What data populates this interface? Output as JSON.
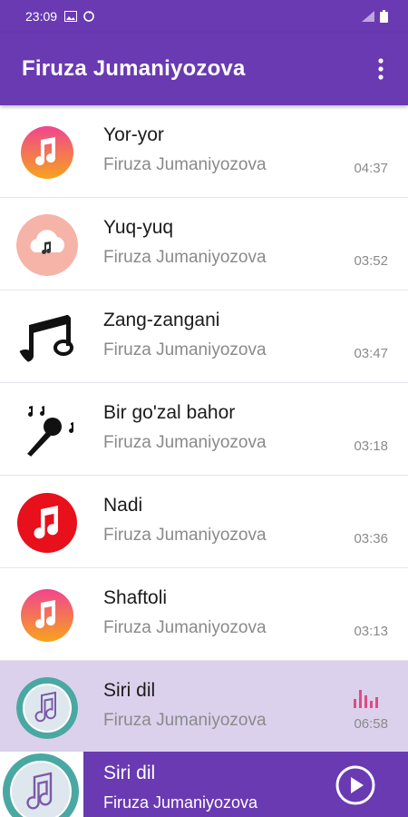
{
  "status_bar": {
    "time": "23:09"
  },
  "app_bar": {
    "title": "Firuza Jumaniyozova",
    "menu_icon": "more-vert-icon"
  },
  "tracks": [
    {
      "title": "Yor-yor",
      "artist": "Firuza Jumaniyozova",
      "duration": "04:37",
      "icon": "music-note-gradient-icon"
    },
    {
      "title": "Yuq-yuq",
      "artist": "Firuza Jumaniyozova",
      "duration": "03:52",
      "icon": "cloud-music-icon"
    },
    {
      "title": "Zang-zangani",
      "artist": "Firuza Jumaniyozova",
      "duration": "03:47",
      "icon": "beamed-notes-icon"
    },
    {
      "title": "Bir go'zal bahor",
      "artist": "Firuza Jumaniyozova",
      "duration": "03:18",
      "icon": "microphone-icon"
    },
    {
      "title": "Nadi",
      "artist": "Firuza Jumaniyozova",
      "duration": "03:36",
      "icon": "music-note-red-icon"
    },
    {
      "title": "Shaftoli",
      "artist": "Firuza Jumaniyozova",
      "duration": "03:13",
      "icon": "music-note-gradient-icon"
    },
    {
      "title": "Siri dil",
      "artist": "Firuza Jumaniyozova",
      "duration": "06:58",
      "icon": "music-note-teal-icon",
      "playing": true
    }
  ],
  "now_playing": {
    "title": "Siri dil",
    "artist": "Firuza Jumaniyozova",
    "button_icon": "play-icon"
  },
  "colors": {
    "primary": "#6a3ab2",
    "active_row": "#dcd1ec",
    "equalizer": "#e24b86"
  }
}
